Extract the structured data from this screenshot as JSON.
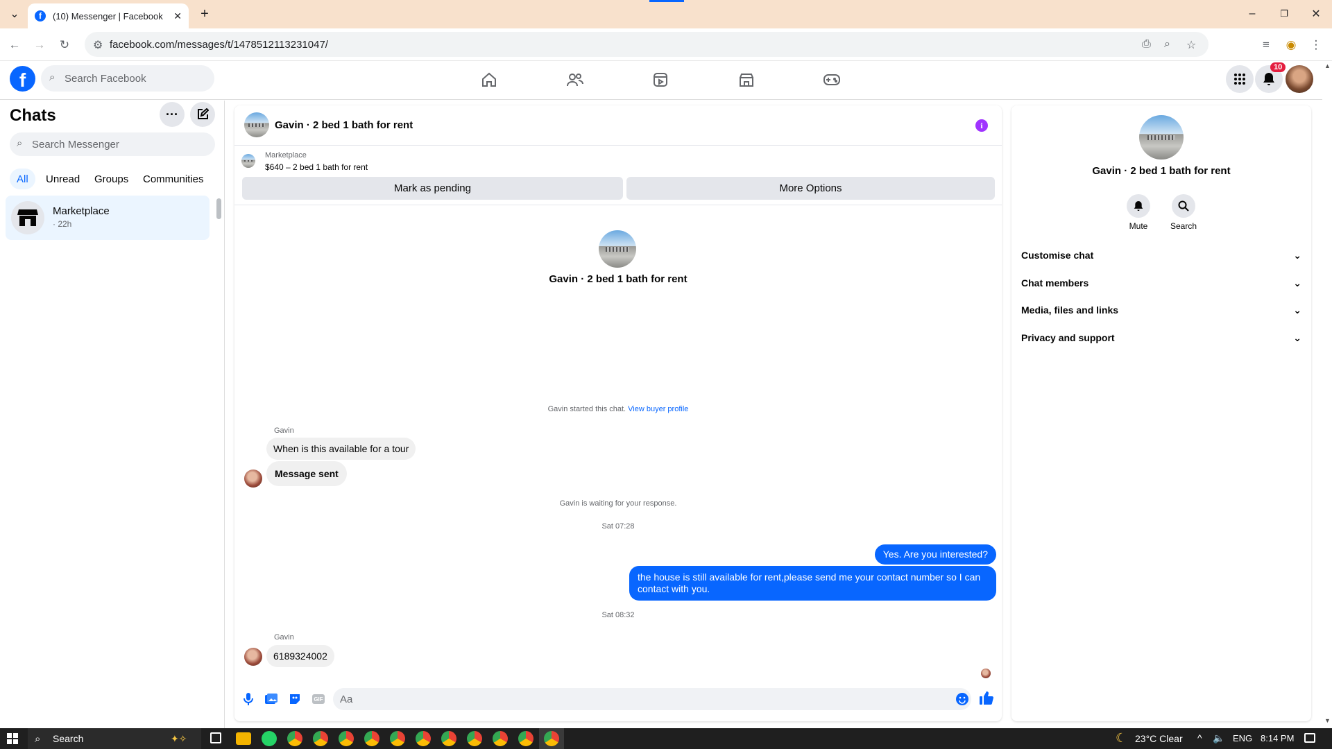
{
  "browser": {
    "tab_title": "(10) Messenger | Facebook",
    "url": "facebook.com/messages/t/1478512113231047/",
    "new_tab": "+"
  },
  "fb": {
    "search_placeholder": "Search Facebook",
    "notification_count": "10",
    "brand_color": "#0866ff"
  },
  "left": {
    "title": "Chats",
    "search_placeholder": "Search Messenger",
    "filters": [
      "All",
      "Unread",
      "Groups",
      "Communities"
    ],
    "chat": {
      "name": "Marketplace",
      "time": "· 22h"
    }
  },
  "center": {
    "header_title": "Gavin · 2 bed 1 bath for rent",
    "marketplace_label": "Marketplace",
    "listing": "$640 – 2 bed 1 bath for rent",
    "mark_pending": "Mark as pending",
    "more_options": "More Options",
    "profile_name": "Gavin · 2 bed 1 bath for rent",
    "started_text": "Gavin started this chat.",
    "view_profile": "View buyer profile",
    "sender1": "Gavin",
    "msg1": "When is this available for a tour",
    "msg2": "Message sent",
    "waiting": "Gavin is waiting for your response.",
    "time1": "Sat 07:28",
    "out1": "Yes. Are you interested?",
    "out2": "the house is still available for rent,please send me your contact number so I can contact with you.",
    "time2": "Sat 08:32",
    "sender2": "Gavin",
    "msg3": "6189324002",
    "composer_placeholder": "Aa"
  },
  "right": {
    "name": "Gavin · 2 bed 1 bath for rent",
    "mute": "Mute",
    "search": "Search",
    "sections": [
      "Customise chat",
      "Chat members",
      "Media, files and links",
      "Privacy and support"
    ]
  },
  "taskbar": {
    "search": "Search",
    "weather": "23°C  Clear",
    "lang": "ENG",
    "time": "8:14 PM"
  }
}
